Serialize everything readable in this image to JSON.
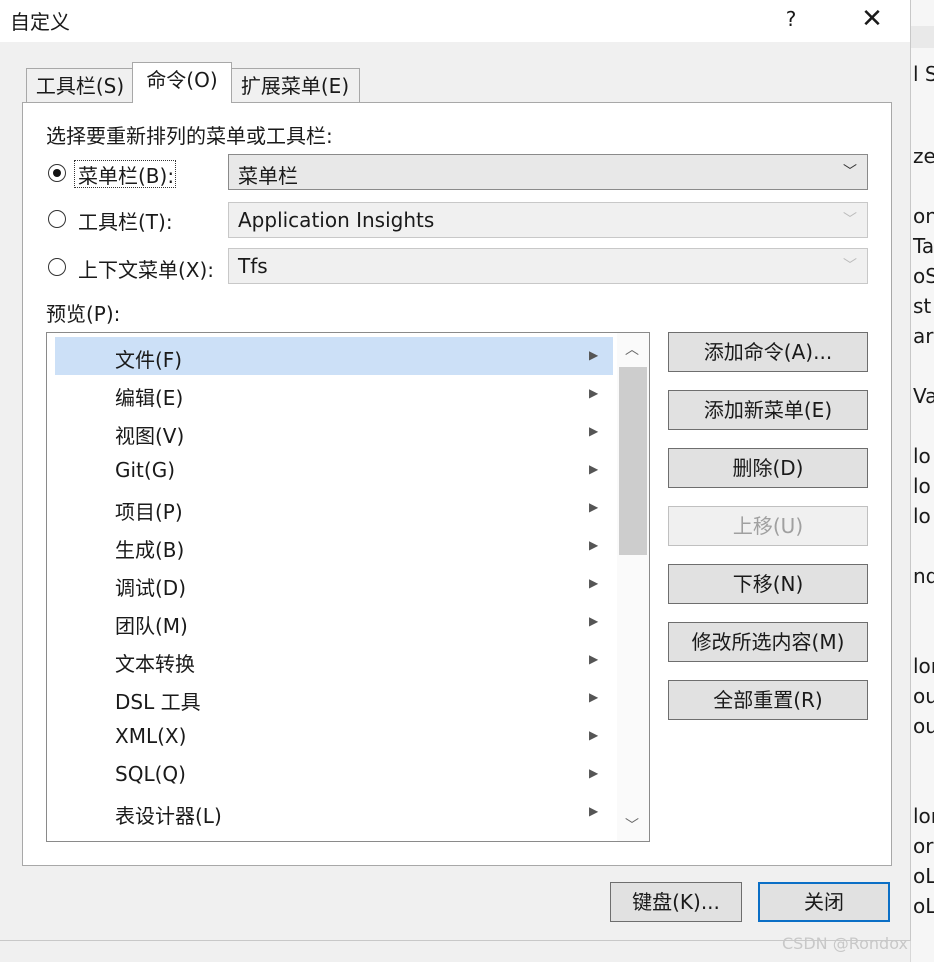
{
  "window": {
    "title": "自定义",
    "help": "?",
    "close": "✕"
  },
  "tabs": [
    "工具栏(S)",
    "命令(O)",
    "扩展菜单(E)"
  ],
  "section_label": "选择要重新排列的菜单或工具栏:",
  "options": [
    {
      "label": "菜单栏(B):",
      "value": "菜单栏",
      "selected": true
    },
    {
      "label": "工具栏(T):",
      "value": "Application Insights",
      "selected": false
    },
    {
      "label": "上下文菜单(X):",
      "value": "Tfs",
      "selected": false
    }
  ],
  "preview_label": "预览(P):",
  "menu_items": [
    "文件(F)",
    "编辑(E)",
    "视图(V)",
    "Git(G)",
    "项目(P)",
    "生成(B)",
    "调试(D)",
    "团队(M)",
    "文本转换",
    "DSL 工具",
    "XML(X)",
    "SQL(Q)",
    "表设计器(L)"
  ],
  "buttons": {
    "add_command": "添加命令(A)...",
    "add_menu": "添加新菜单(E)",
    "delete": "删除(D)",
    "move_up": "上移(U)",
    "move_down": "下移(N)",
    "modify": "修改所选内容(M)",
    "reset_all": "全部重置(R)",
    "keyboard": "键盘(K)...",
    "close": "关闭"
  },
  "background_fragments": [
    "l S",
    "zel",
    "on",
    "Ta",
    "oS",
    "st",
    "are",
    "Va",
    "lo",
    "lo",
    "lo",
    "nd",
    "lon",
    "our",
    "our",
    "lon",
    "ord",
    "oLe",
    "oLe"
  ],
  "watermark": "CSDN @Rondox",
  "colors": {
    "selection": "#cce0f7",
    "default_button_border": "#0b6fc6"
  }
}
